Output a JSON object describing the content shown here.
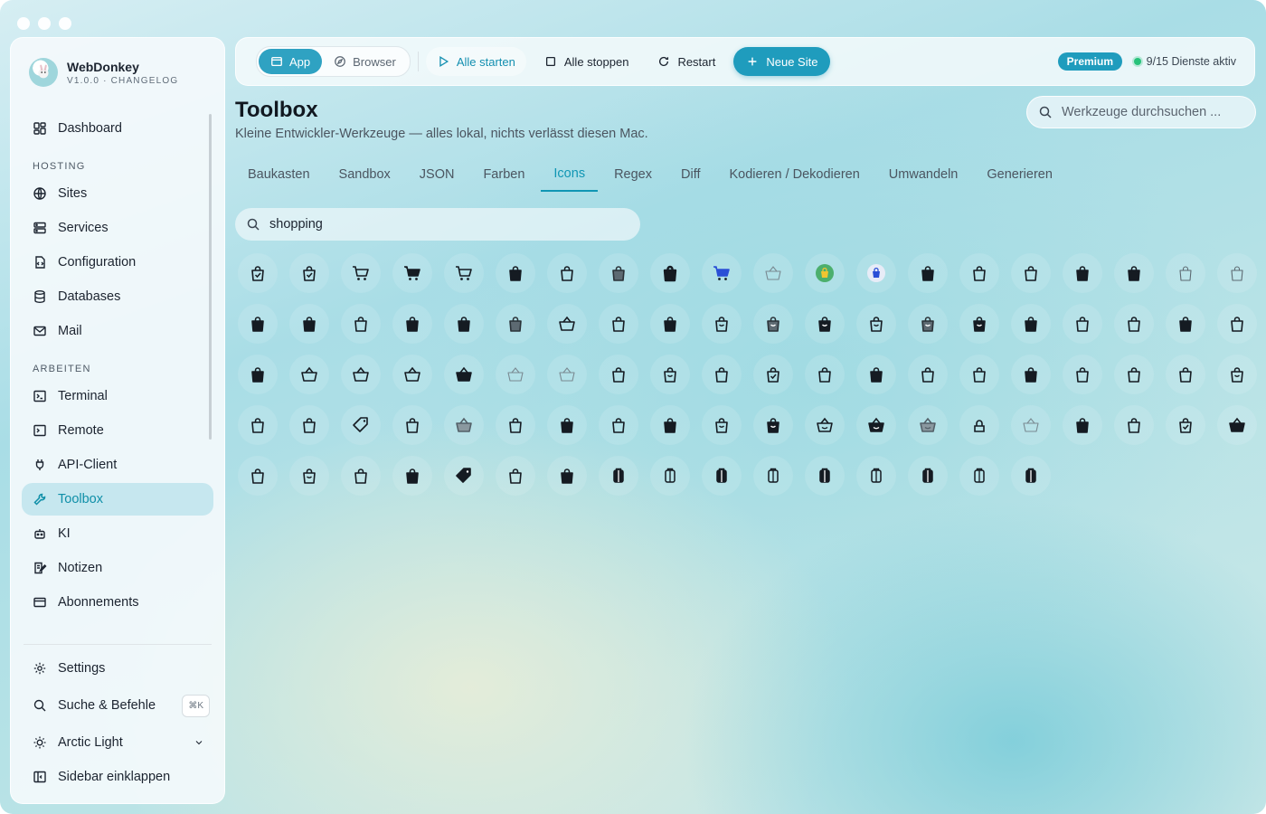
{
  "app": {
    "name": "WebDonkey",
    "version": "V1.0.0 · CHANGELOG"
  },
  "sidebar": {
    "dashboard": "Dashboard",
    "section_hosting": "HOSTING",
    "hosting": [
      "Sites",
      "Services",
      "Configuration",
      "Databases",
      "Mail"
    ],
    "section_work": "ARBEITEN",
    "work": [
      "Terminal",
      "Remote",
      "API-Client",
      "Toolbox",
      "KI",
      "Notizen",
      "Abonnements"
    ],
    "active": "Toolbox",
    "settings": "Settings",
    "search": "Suche & Befehle",
    "search_shortcut": "⌘K",
    "theme": "Arctic Light",
    "collapse": "Sidebar einklappen"
  },
  "toolbar": {
    "mode_app": "App",
    "mode_browser": "Browser",
    "start_all": "Alle starten",
    "stop_all": "Alle stoppen",
    "restart": "Restart",
    "new_site": "Neue Site",
    "premium": "Premium",
    "status": "9/15 Dienste aktiv"
  },
  "page": {
    "title": "Toolbox",
    "subtitle": "Kleine Entwickler-Werkzeuge — alles lokal, nichts verlässt diesen Mac.",
    "search_placeholder": "Werkzeuge durchsuchen ..."
  },
  "tabs": [
    "Baukasten",
    "Sandbox",
    "JSON",
    "Farben",
    "Icons",
    "Regex",
    "Diff",
    "Kodieren / Dekodieren",
    "Umwandeln",
    "Generieren"
  ],
  "active_tab": "Icons",
  "icon_search": {
    "value": "shopping"
  },
  "colors": {
    "accent": "#1f9cbd",
    "status_ok": "#27c27a",
    "icon": "#151b22"
  },
  "icons": [
    "bag-check",
    "bag-check-outline",
    "cart-outline",
    "cart-filled",
    "cart-outline-alt",
    "bag-filled",
    "bag-outline",
    "bag-filled-grey",
    "bag-bold",
    "cart-color",
    "basket-light",
    "bag-color-yellow",
    "bag-color-blue",
    "bag-filled",
    "bag-outline",
    "bag-outline",
    "bag-filled",
    "bag-filled-small",
    "bag-thin",
    "bag-thin",
    "bag-filled-small",
    "bag-filled",
    "bag-outline",
    "bag-filled",
    "bag-filled",
    "bag-filled-grey",
    "basket-outline",
    "bag-outline",
    "bag-filled",
    "bag-box-outline",
    "bag-box-grey",
    "bag-box-filled",
    "bag-box-outline",
    "bag-box-grey",
    "bag-box-filled",
    "bag-filled",
    "bag-outline",
    "bag-rounded-outline",
    "bag-rounded-filled",
    "bag-outline-tall",
    "bag-filled",
    "basket-outline",
    "basket-outline",
    "basket-outline",
    "basket-filled",
    "basket-light",
    "basket-light",
    "bag-rounded-outline",
    "bag-box-outline",
    "bag-outline",
    "bag-check-outline",
    "bag-outline",
    "bag-filled",
    "bag-outline",
    "bag-outline",
    "bag-filled",
    "bag-outline",
    "bag-outline",
    "bag-outline",
    "bag-box-outline",
    "bag-outline",
    "bag-outline",
    "tag-outline",
    "bag-outline",
    "basket-grey",
    "bag-rounded-outline",
    "bag-rounded-filled",
    "bag-outline",
    "bag-filled",
    "bag-box-outline",
    "bag-box-filled",
    "basket-smile",
    "basket-smile-filled",
    "basket-smile-grey",
    "bag-lock",
    "basket-light",
    "bag-filled",
    "bag-outline",
    "bag-check-outline",
    "basket-filled",
    "bag-outline",
    "bag-box-outline",
    "bag-half",
    "bag-wide-filled",
    "tag-filled",
    "bag-outline-wide",
    "bag-filled-wide",
    "gift-filled",
    "gift-outline",
    "gift-filled",
    "gift-outline",
    "gift-filled",
    "gift-outline",
    "gift-filled",
    "gift-outline",
    "gift-filled"
  ]
}
